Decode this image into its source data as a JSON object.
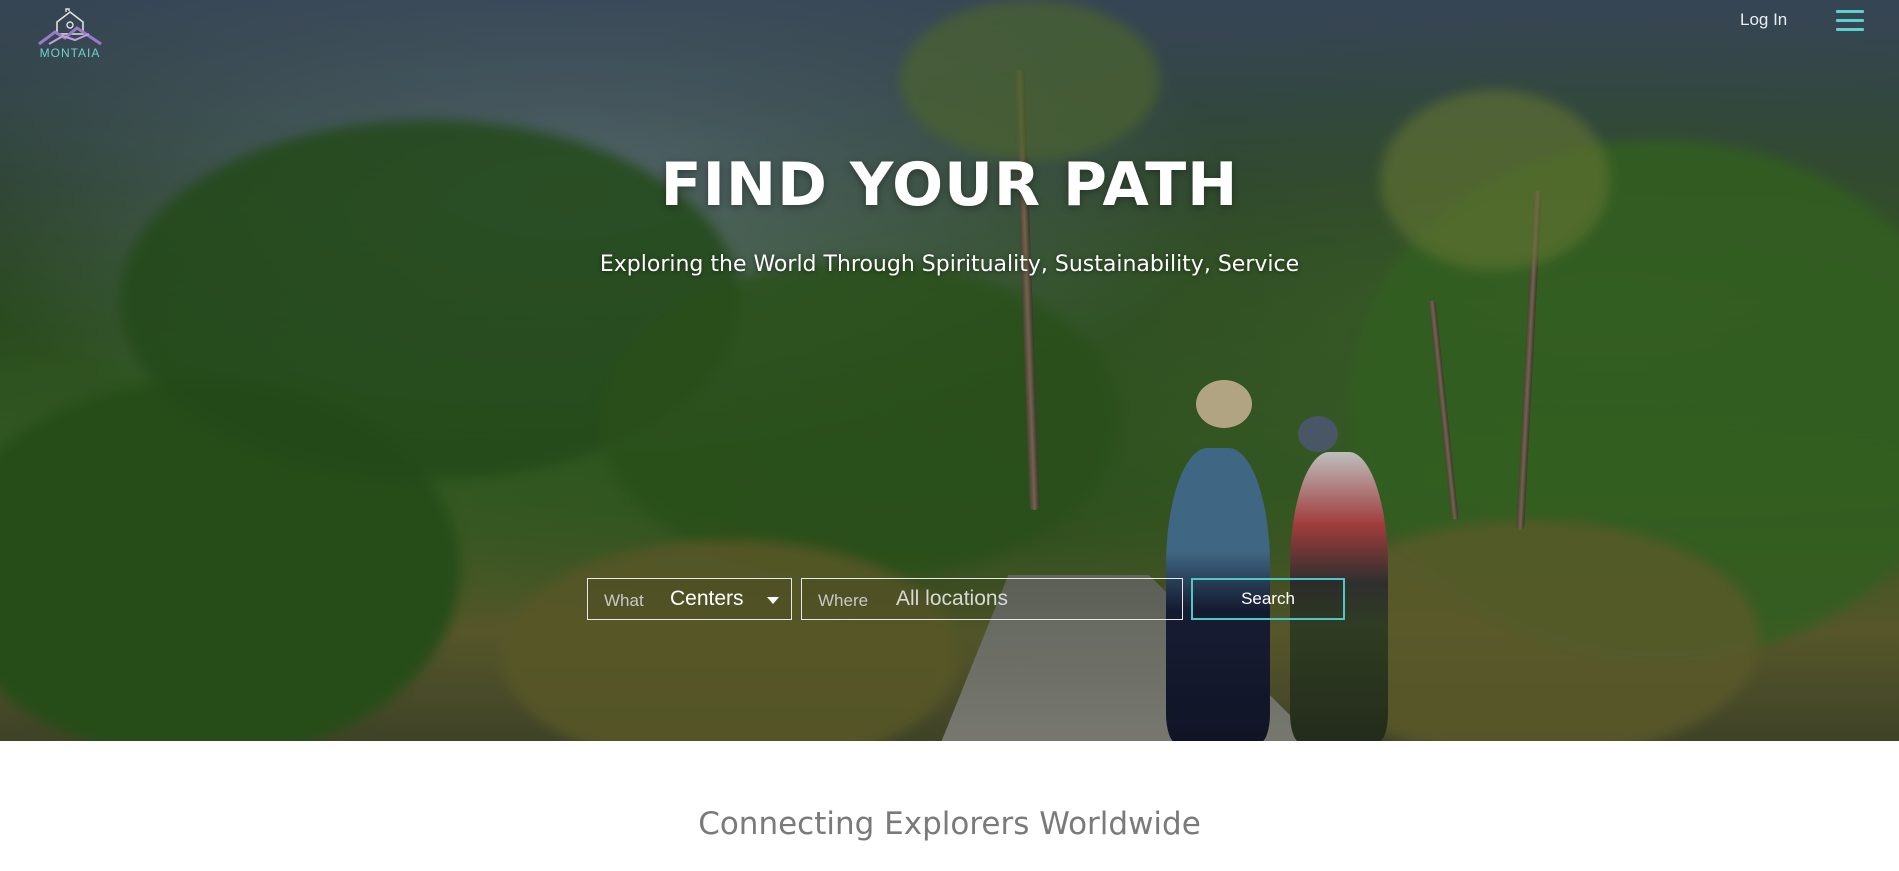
{
  "header": {
    "logo_text": "MONTAIA",
    "login_label": "Log In"
  },
  "hero": {
    "title": "FIND YOUR PATH",
    "subtitle": "Exploring the World Through Spirituality, Sustainability, Service"
  },
  "search": {
    "what_label": "What",
    "what_value": "Centers",
    "where_label": "Where",
    "where_placeholder": "All locations",
    "button_label": "Search"
  },
  "section": {
    "tagline": "Connecting Explorers Worldwide"
  },
  "colors": {
    "accent": "#4fc8c4",
    "logo": "#6fd0d0"
  },
  "icons": {
    "menu": "hamburger-menu-icon",
    "dropdown": "caret-down-icon",
    "logo": "mountain-house-logo"
  }
}
